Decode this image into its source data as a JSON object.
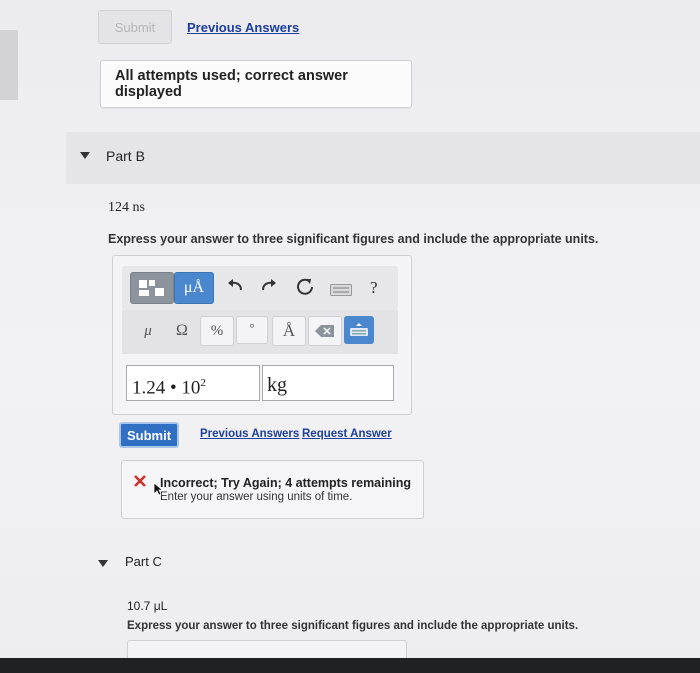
{
  "top": {
    "submit_label": "Submit",
    "previous_answers_label": "Previous Answers",
    "alert_text": "All attempts used; correct answer displayed"
  },
  "part_b": {
    "title": "Part B",
    "value_text": "124 ns",
    "instruction": "Express your answer to three significant figures and include the appropriate units.",
    "toolbar": {
      "mu_angstrom_label": "μÅ",
      "help_label": "?",
      "symbols": [
        "μ",
        "Ω",
        "%",
        "°",
        "Å"
      ]
    },
    "answer_value": "1.24 • 10",
    "answer_exponent": "2",
    "answer_units": "kg",
    "submit_label": "Submit",
    "previous_answers_label": "Previous Answers",
    "request_answer_label": "Request Answer",
    "feedback_title": "Incorrect; Try Again; 4 attempts remaining",
    "feedback_detail": "Enter your answer using units of time."
  },
  "part_c": {
    "title": "Part C",
    "value_text": "10.7 μL",
    "instruction": "Express your answer to three significant figures and include the appropriate units."
  },
  "icons": [
    "templates-icon",
    "undo-icon",
    "redo-icon",
    "reset-icon",
    "keyboard-icon",
    "backspace-icon",
    "caret-down-icon",
    "error-x-icon"
  ]
}
